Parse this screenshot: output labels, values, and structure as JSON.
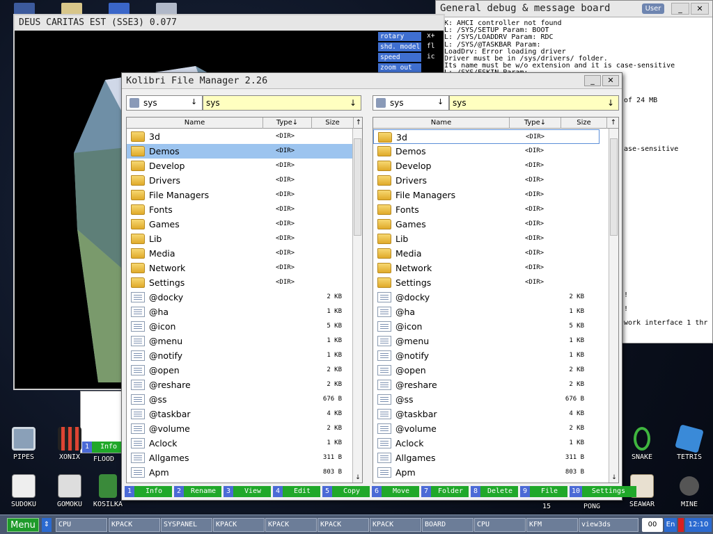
{
  "desktop": {
    "icons": [
      {
        "label": "PIPES",
        "name": "pipes-icon"
      },
      {
        "label": "XONIX",
        "name": "xonix-icon"
      },
      {
        "label": "FLOOD",
        "name": "flood-icon"
      },
      {
        "label": "SUDOKU",
        "name": "sudoku-icon"
      },
      {
        "label": "GOMOKU",
        "name": "gomoku-icon"
      },
      {
        "label": "KOSILKA",
        "name": "kosilka-icon"
      },
      {
        "label": "SNAKE",
        "name": "snake-icon"
      },
      {
        "label": "TETRIS",
        "name": "tetris-icon"
      },
      {
        "label": "SEAWAR",
        "name": "seawar-icon"
      },
      {
        "label": "MINE",
        "name": "mine-icon"
      },
      {
        "label": "15",
        "name": "fifteen-icon"
      },
      {
        "label": "PONG",
        "name": "pong-icon"
      }
    ]
  },
  "board": {
    "title": "General debug & message board",
    "user_label": "User",
    "min": "_",
    "close": "✕",
    "log": "K: AHCI controller not found\nL: /SYS/SETUP Param: BOOT\nL: /SYS/LOADDRV Param: RDC\nL: /SYS/@TASKBAR Param:\nLoadDrv: Error loading driver\nDriver must be in /sys/drivers/ folder.\nIts name must be w/o extension and it is case-sensitive\nL: /SYS/ESKIN Param:",
    "log_fragments": [
      "of 24 MB",
      "ase-sensitive",
      "!",
      "!",
      "work interface 1 thr"
    ]
  },
  "viewer": {
    "title": "DEUS CARITAS EST (SSE3) 0.077",
    "buttons": [
      "rotary",
      "shd. model",
      "speed",
      "zoom out"
    ],
    "side_values": [
      "x+",
      "fl",
      "ic"
    ]
  },
  "kfm_back": {
    "fkey_num": "1",
    "fkey_label": "Info"
  },
  "kfm": {
    "title": "Kolibri File Manager 2.26",
    "min": "_",
    "close": "✕",
    "left": {
      "drive": "sys",
      "path": "sys"
    },
    "right": {
      "drive": "sys",
      "path": "sys"
    },
    "columns": {
      "name": "Name",
      "type": "Type↓",
      "size": "Size",
      "sort": "↑"
    },
    "rows": [
      {
        "name": "3d",
        "type": "<DIR>",
        "size": "",
        "kind": "folder"
      },
      {
        "name": "Demos",
        "type": "<DIR>",
        "size": "",
        "kind": "folder"
      },
      {
        "name": "Develop",
        "type": "<DIR>",
        "size": "",
        "kind": "folder"
      },
      {
        "name": "Drivers",
        "type": "<DIR>",
        "size": "",
        "kind": "folder"
      },
      {
        "name": "File Managers",
        "type": "<DIR>",
        "size": "",
        "kind": "folder"
      },
      {
        "name": "Fonts",
        "type": "<DIR>",
        "size": "",
        "kind": "folder"
      },
      {
        "name": "Games",
        "type": "<DIR>",
        "size": "",
        "kind": "folder"
      },
      {
        "name": "Lib",
        "type": "<DIR>",
        "size": "",
        "kind": "folder"
      },
      {
        "name": "Media",
        "type": "<DIR>",
        "size": "",
        "kind": "folder"
      },
      {
        "name": "Network",
        "type": "<DIR>",
        "size": "",
        "kind": "folder"
      },
      {
        "name": "Settings",
        "type": "<DIR>",
        "size": "",
        "kind": "folder"
      },
      {
        "name": "@docky",
        "type": "",
        "size": "2 KB",
        "kind": "file"
      },
      {
        "name": "@ha",
        "type": "",
        "size": "1 KB",
        "kind": "file"
      },
      {
        "name": "@icon",
        "type": "",
        "size": "5 KB",
        "kind": "file"
      },
      {
        "name": "@menu",
        "type": "",
        "size": "1 KB",
        "kind": "file"
      },
      {
        "name": "@notify",
        "type": "",
        "size": "1 KB",
        "kind": "file"
      },
      {
        "name": "@open",
        "type": "",
        "size": "2 KB",
        "kind": "file"
      },
      {
        "name": "@reshare",
        "type": "",
        "size": "2 KB",
        "kind": "file"
      },
      {
        "name": "@ss",
        "type": "",
        "size": "676 B",
        "kind": "file"
      },
      {
        "name": "@taskbar",
        "type": "",
        "size": "4 KB",
        "kind": "file"
      },
      {
        "name": "@volume",
        "type": "",
        "size": "2 KB",
        "kind": "file"
      },
      {
        "name": "Aclock",
        "type": "",
        "size": "1 KB",
        "kind": "file"
      },
      {
        "name": "Allgames",
        "type": "",
        "size": "311 B",
        "kind": "file"
      },
      {
        "name": "Apm",
        "type": "",
        "size": "803 B",
        "kind": "file"
      }
    ],
    "fkeys": [
      {
        "num": "1",
        "label": "Info"
      },
      {
        "num": "2",
        "label": "Rename"
      },
      {
        "num": "3",
        "label": "View"
      },
      {
        "num": "4",
        "label": "Edit"
      },
      {
        "num": "5",
        "label": "Copy"
      },
      {
        "num": "6",
        "label": "Move"
      },
      {
        "num": "7",
        "label": "Folder"
      },
      {
        "num": "8",
        "label": "Delete"
      },
      {
        "num": "9",
        "label": "File"
      },
      {
        "num": "10",
        "label": "Settings"
      }
    ]
  },
  "taskbar": {
    "menu": "Menu",
    "switch": "⇕",
    "tasks": [
      "CPU",
      "KPACK",
      "SYSPANEL",
      "KPACK",
      "KPACK",
      "KPACK",
      "KPACK",
      "BOARD",
      "CPU",
      "KFM",
      "view3ds"
    ],
    "counter": "00",
    "lang": "En",
    "clock": "12:10"
  }
}
